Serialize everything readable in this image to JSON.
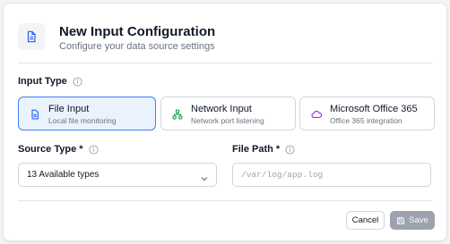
{
  "dialog": {
    "title": "New Input Configuration",
    "subtitle": "Configure your data source settings",
    "header_icon": "document-icon"
  },
  "input_type": {
    "label": "Input Type",
    "options": [
      {
        "label": "File Input",
        "description": "Local file monitoring",
        "icon": "file-icon",
        "selected": true
      },
      {
        "label": "Network Input",
        "description": "Network port listening",
        "icon": "network-icon",
        "selected": false
      },
      {
        "label": "Microsoft Office 365",
        "description": "Office 365 integration",
        "icon": "cloud-icon",
        "selected": false
      }
    ]
  },
  "source_type": {
    "label": "Source Type *",
    "value": "13 Available types"
  },
  "file_path": {
    "label": "File Path *",
    "placeholder": "/var/log/app.log",
    "value": ""
  },
  "footer": {
    "cancel_label": "Cancel",
    "save_label": "Save"
  },
  "colors": {
    "accent": "#3b82f6",
    "selected_bg": "#eaf2fd",
    "disabled_button": "#9ca3af"
  }
}
